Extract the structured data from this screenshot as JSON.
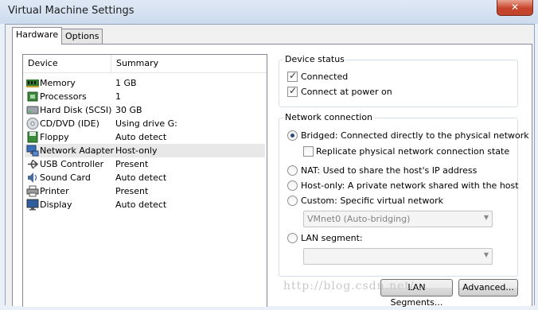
{
  "window": {
    "title": "Virtual Machine Settings"
  },
  "tabs": [
    {
      "label": "Hardware"
    },
    {
      "label": "Options"
    }
  ],
  "device_list": {
    "headers": {
      "device": "Device",
      "summary": "Summary"
    },
    "rows": [
      {
        "name": "Memory",
        "summary": "1 GB",
        "icon": "memory-icon"
      },
      {
        "name": "Processors",
        "summary": "1",
        "icon": "processor-icon"
      },
      {
        "name": "Hard Disk (SCSI)",
        "summary": "30 GB",
        "icon": "hard-disk-icon"
      },
      {
        "name": "CD/DVD (IDE)",
        "summary": "Using drive G:",
        "icon": "cd-dvd-icon"
      },
      {
        "name": "Floppy",
        "summary": "Auto detect",
        "icon": "floppy-icon"
      },
      {
        "name": "Network Adapter",
        "summary": "Host-only",
        "icon": "network-adapter-icon",
        "selected": true
      },
      {
        "name": "USB Controller",
        "summary": "Present",
        "icon": "usb-icon"
      },
      {
        "name": "Sound Card",
        "summary": "Auto detect",
        "icon": "sound-card-icon"
      },
      {
        "name": "Printer",
        "summary": "Present",
        "icon": "printer-icon"
      },
      {
        "name": "Display",
        "summary": "Auto detect",
        "icon": "display-icon"
      }
    ]
  },
  "device_status": {
    "legend": "Device status",
    "connected": {
      "label": "Connected",
      "checked": true
    },
    "connect_at_power_on": {
      "label": "Connect at power on",
      "checked": true
    }
  },
  "network_connection": {
    "legend": "Network connection",
    "bridged": {
      "label": "Bridged: Connected directly to the physical network",
      "selected": true
    },
    "replicate": {
      "label": "Replicate physical network connection state",
      "checked": false
    },
    "nat": {
      "label": "NAT: Used to share the host's IP address",
      "selected": false
    },
    "host_only": {
      "label": "Host-only: A private network shared with the host",
      "selected": false
    },
    "custom": {
      "label": "Custom: Specific virtual network",
      "selected": false
    },
    "custom_select": {
      "value": "VMnet0 (Auto-bridging)"
    },
    "lan_segment": {
      "label": "LAN segment:",
      "selected": false
    },
    "lan_select": {
      "value": ""
    }
  },
  "buttons": {
    "lan_segments": "LAN Segments...",
    "advanced": "Advanced..."
  },
  "watermark": "http://blog.csdn.net/..."
}
